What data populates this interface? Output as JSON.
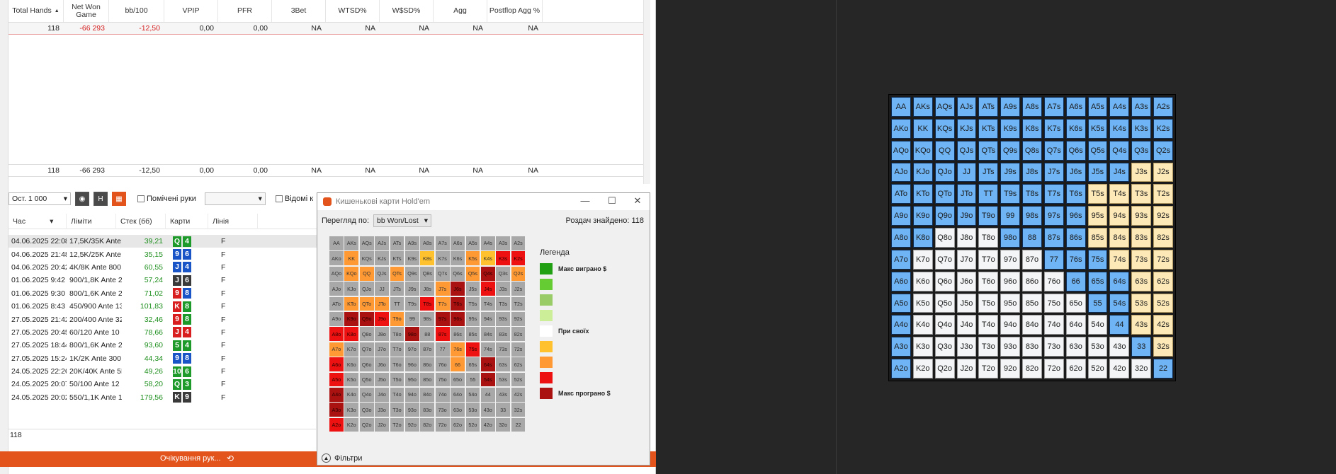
{
  "stats": {
    "headers": [
      "Total Hands",
      "Net Won Game",
      "bb/100",
      "VPIP",
      "PFR",
      "3Bet",
      "WTSD%",
      "W$SD%",
      "Agg",
      "Postflop Agg %"
    ],
    "row": [
      "118",
      "-66 293",
      "-12,50",
      "0,00",
      "0,00",
      "NA",
      "NA",
      "NA",
      "NA",
      "NA"
    ],
    "footer": [
      "118",
      "-66 293",
      "-12,50",
      "0,00",
      "0,00",
      "NA",
      "NA",
      "NA",
      "NA",
      "NA"
    ]
  },
  "toolbar": {
    "limit_combo": "Ост. 1 000",
    "btn_h": "H",
    "marked_hands_label": "Помічені руки",
    "known_cards_label": "Відомі к"
  },
  "hands_table": {
    "headers": [
      "Час",
      "Ліміти",
      "Стек (бб)",
      "Карти",
      "Лінія"
    ],
    "rows": [
      {
        "time": "04.06.2025 22:08",
        "limit": "17,5K/35K Ante",
        "stack": "39,21",
        "cards": [
          [
            "Q",
            "c"
          ],
          [
            "4",
            "c"
          ]
        ],
        "line": "F"
      },
      {
        "time": "04.06.2025 21:48",
        "limit": "12,5K/25K Ante",
        "stack": "35,15",
        "cards": [
          [
            "9",
            "d"
          ],
          [
            "6",
            "d"
          ]
        ],
        "line": "F"
      },
      {
        "time": "04.06.2025 20:42",
        "limit": "4K/8K Ante 800",
        "stack": "60,55",
        "cards": [
          [
            "J",
            "d"
          ],
          [
            "4",
            "d"
          ]
        ],
        "line": "F"
      },
      {
        "time": "01.06.2025 9:42",
        "limit": "900/1,8K Ante 2",
        "stack": "57,24",
        "cards": [
          [
            "J",
            "s"
          ],
          [
            "6",
            "s"
          ]
        ],
        "line": "F"
      },
      {
        "time": "01.06.2025 9:30",
        "limit": "800/1,6K Ante 2",
        "stack": "71,02",
        "cards": [
          [
            "9",
            "h"
          ],
          [
            "8",
            "d"
          ]
        ],
        "line": "F"
      },
      {
        "time": "01.06.2025 8:43",
        "limit": "450/900 Ante 13",
        "stack": "101,83",
        "cards": [
          [
            "K",
            "h"
          ],
          [
            "8",
            "c"
          ]
        ],
        "line": "F"
      },
      {
        "time": "27.05.2025 21:42",
        "limit": "200/400 Ante 32",
        "stack": "32,46",
        "cards": [
          [
            "9",
            "h"
          ],
          [
            "8",
            "c"
          ]
        ],
        "line": "F"
      },
      {
        "time": "27.05.2025 20:45",
        "limit": "60/120 Ante 10 I",
        "stack": "78,66",
        "cards": [
          [
            "J",
            "h"
          ],
          [
            "4",
            "h"
          ]
        ],
        "line": "F"
      },
      {
        "time": "27.05.2025 18:44",
        "limit": "800/1,6K Ante 2",
        "stack": "93,60",
        "cards": [
          [
            "5",
            "c"
          ],
          [
            "4",
            "c"
          ]
        ],
        "line": "F"
      },
      {
        "time": "27.05.2025 15:24",
        "limit": "1K/2K Ante 300",
        "stack": "44,34",
        "cards": [
          [
            "9",
            "d"
          ],
          [
            "8",
            "d"
          ]
        ],
        "line": "F"
      },
      {
        "time": "24.05.2025 22:26",
        "limit": "20K/40K Ante 5K",
        "stack": "49,26",
        "cards": [
          [
            "10",
            "c"
          ],
          [
            "6",
            "c"
          ]
        ],
        "line": "F"
      },
      {
        "time": "24.05.2025 20:07",
        "limit": "50/100 Ante 12 I",
        "stack": "58,20",
        "cards": [
          [
            "Q",
            "c"
          ],
          [
            "3",
            "c"
          ]
        ],
        "line": "F"
      },
      {
        "time": "24.05.2025 20:02",
        "limit": "550/1,1K Ante 1",
        "stack": "179,56",
        "cards": [
          [
            "K",
            "s"
          ],
          [
            "9",
            "s"
          ]
        ],
        "line": "F"
      }
    ],
    "count": "118"
  },
  "status_bar": {
    "text": "Очікування рук..."
  },
  "popup": {
    "title": "Кишенькові карти Hold'em",
    "view_label": "Перегляд по:",
    "view_value": "bb Won/Lost",
    "found_text": "Роздач знайдено: 118",
    "legend_title": "Легенда",
    "legend": [
      {
        "color": "#22a014",
        "label": "Макс виграно $"
      },
      {
        "color": "#66cc33",
        "label": ""
      },
      {
        "color": "#99cc66",
        "label": ""
      },
      {
        "color": "#ccee99",
        "label": ""
      },
      {
        "color": "#ffffff",
        "label": "При своїх"
      },
      {
        "color": "#ffc22e",
        "label": ""
      },
      {
        "color": "#ff9933",
        "label": ""
      },
      {
        "color": "#ee1111",
        "label": ""
      },
      {
        "color": "#aa1111",
        "label": "Макс програно $"
      }
    ],
    "filters_label": "Фільтри",
    "colors": {
      "gray": "#a8a8a8",
      "yellow": "#ffc22e",
      "orange": "#ff9933",
      "red": "#ee1111",
      "darkred": "#aa1111"
    },
    "hot_cells": {
      "1,1": "orange",
      "1,6": "yellow",
      "1,9": "orange",
      "1,10": "yellow",
      "1,11": "red",
      "1,12": "red",
      "2,1": "orange",
      "2,2": "orange",
      "2,4": "orange",
      "2,9": "orange",
      "2,10": "darkred",
      "2,12": "orange",
      "3,7": "orange",
      "3,8": "darkred",
      "3,10": "red",
      "4,1": "orange",
      "4,2": "orange",
      "4,3": "orange",
      "4,6": "red",
      "4,7": "orange",
      "4,8": "darkred",
      "5,1": "darkred",
      "5,2": "darkred",
      "5,3": "red",
      "5,4": "orange",
      "5,7": "darkred",
      "5,8": "darkred",
      "6,0": "red",
      "6,1": "red",
      "6,5": "darkred",
      "6,7": "red",
      "7,0": "orange",
      "7,8": "orange",
      "7,9": "red",
      "8,0": "red",
      "8,8": "orange",
      "8,10": "darkred",
      "9,0": "red",
      "9,10": "darkred",
      "10,0": "darkred",
      "11,0": "darkred",
      "12,0": "red"
    }
  },
  "hand_grid": {
    "ranks": [
      "A",
      "K",
      "Q",
      "J",
      "T",
      "9",
      "8",
      "7",
      "6",
      "5",
      "4",
      "3",
      "2"
    ],
    "colors": {
      "blue": "#6fb4f4",
      "cream": "#fde9b8",
      "white": "#f4f5f6"
    },
    "row_patterns": [
      "BBBBBBBBBBBBB",
      "BBBBBBBBBBBBB",
      "BBBBBBBBBBBBB",
      "BBBBBBBBBBBCC",
      "BBBBBBBBBCCCC",
      "BBBBBBBBBCCCC",
      "BBWWWBBBBCCCC",
      "BWWWWWWBBBCCC",
      "BWWWWWWWBBBCC",
      "BWWWWWWWWBBCC",
      "BWWWWWWWWWBCC",
      "BWWWWWWWWWWBC",
      "BWWWWWWWWWWWB"
    ]
  }
}
